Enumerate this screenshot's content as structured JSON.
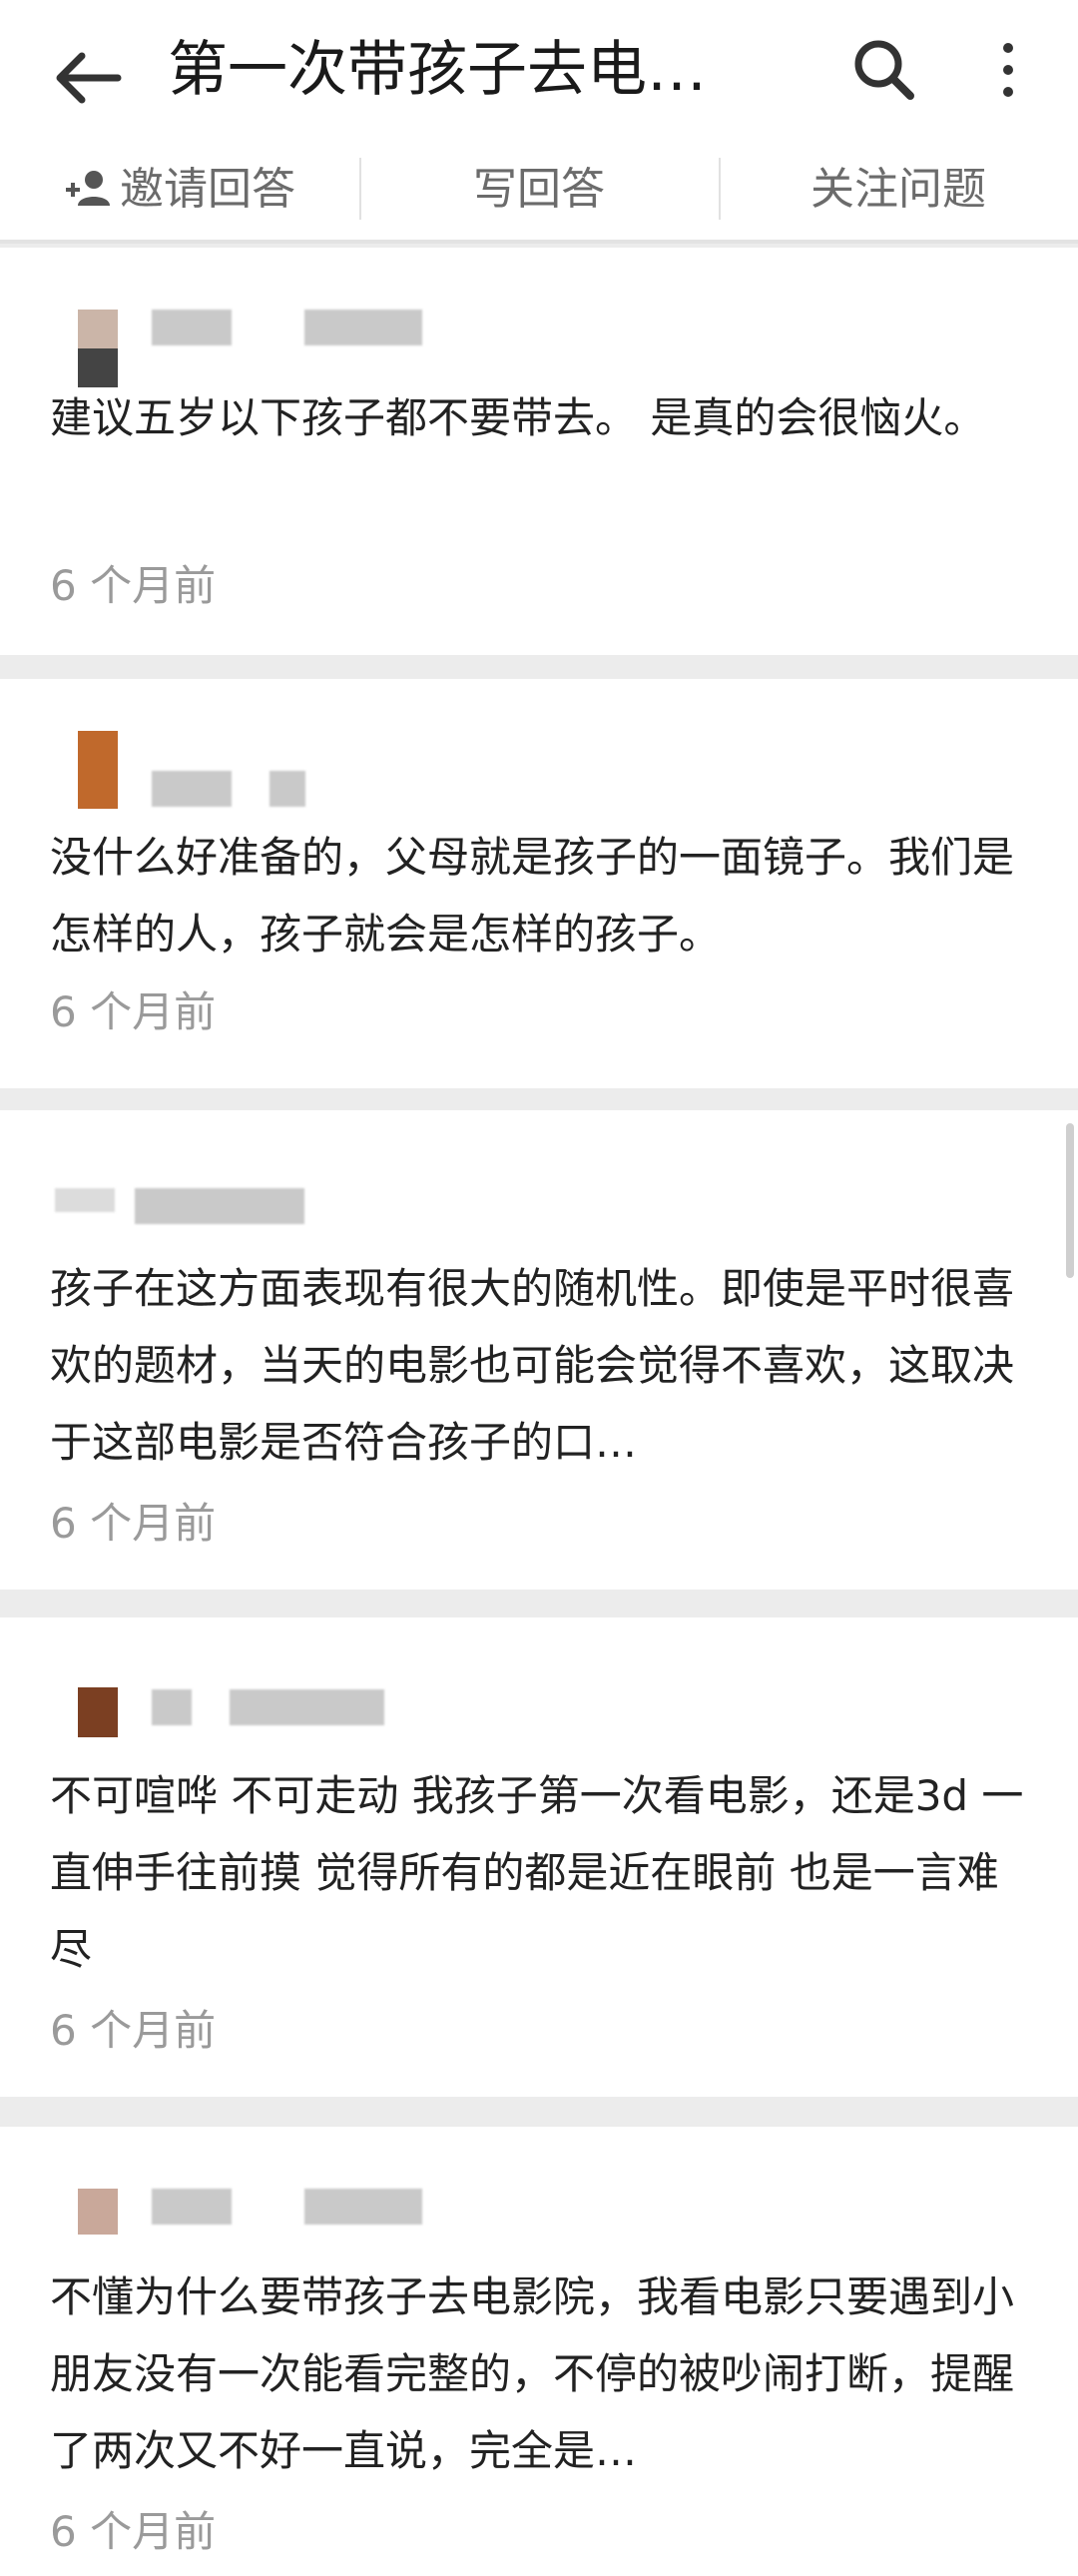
{
  "header": {
    "title": "第一次带孩子去电…"
  },
  "actions": [
    {
      "label": "邀请回答"
    },
    {
      "label": "写回答"
    },
    {
      "label": "关注问题"
    }
  ],
  "comments": [
    {
      "text": "建议五岁以下孩子都不要带去。 是真的会很恼火。",
      "time": "6 个月前",
      "avatar_color": "#8d6e63"
    },
    {
      "text": "没什么好准备的，父母就是孩子的一面镜子。我们是怎样的人，孩子就会是怎样的孩子。",
      "time": "6 个月前",
      "avatar_color": "#c0692c"
    },
    {
      "text": "孩子在这方面表现有很大的随机性。即使是平时很喜欢的题材，当天的电影也可能会觉得不喜欢，这取决于这部电影是否符合孩子的口…",
      "time": "6 个月前",
      "avatar_color": "#d0d0d0"
    },
    {
      "text": "不可喧哗 不可走动 我孩子第一次看电影，还是3d 一直伸手往前摸 觉得所有的都是近在眼前 也是一言难尽",
      "time": "6 个月前",
      "avatar_color": "#7b3f22"
    },
    {
      "text": "不懂为什么要带孩子去电影院，我看电影只要遇到小朋友没有一次能看完整的，不停的被吵闹打断，提醒了两次又不好一直说，完全是…",
      "time": "6 个月前",
      "avatar_color": "#c9a89a"
    }
  ]
}
